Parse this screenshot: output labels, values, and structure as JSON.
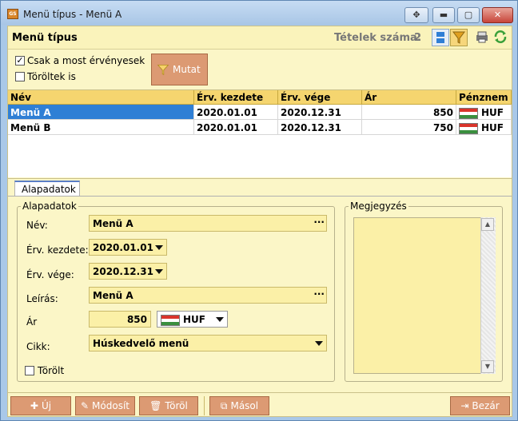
{
  "window": {
    "app_icon": "app-icon",
    "title": "Menü típus - Menü A",
    "caption_buttons": {
      "move": "✥",
      "minimize": "▬",
      "maximize": "▢",
      "close": "✕"
    }
  },
  "header": {
    "title": "Menü típus",
    "count_label": "Tételek száma:",
    "count_value": "2",
    "icons": [
      "layout-icon",
      "filter-icon",
      "printer-icon",
      "refresh-icon"
    ]
  },
  "filters": {
    "only_valid": {
      "label": "Csak a most érvényesek",
      "checked": true
    },
    "deleted_too": {
      "label": "Töröltek is",
      "checked": false
    },
    "show_button": "Mutat"
  },
  "grid": {
    "columns": [
      "Név",
      "Érv. kezdete",
      "Érv. vége",
      "Ár",
      "Pénznem"
    ],
    "rows": [
      {
        "name": "Menü A",
        "start": "2020.01.01",
        "end": "2020.12.31",
        "price": "850",
        "currency": "HUF",
        "selected": true
      },
      {
        "name": "Menü B",
        "start": "2020.01.01",
        "end": "2020.12.31",
        "price": "750",
        "currency": "HUF",
        "selected": false
      }
    ]
  },
  "tabs": [
    {
      "label": "Alapadatok",
      "active": true
    }
  ],
  "form": {
    "group_title": "Alapadatok",
    "name_label": "Név:",
    "name_value": "Menü A",
    "start_label": "Érv. kezdete:",
    "start_value": "2020.01.01",
    "end_label": "Érv. vége:",
    "end_value": "2020.12.31",
    "desc_label": "Leírás:",
    "desc_value": "Menü A",
    "price_label": "Ár",
    "price_value": "850",
    "currency_value": "HUF",
    "item_label": "Cikk:",
    "item_value": "Húskedvelő menü",
    "deleted_label": "Törölt",
    "deleted_checked": false,
    "ellipsis": "···"
  },
  "notes": {
    "title": "Megjegyzés",
    "value": ""
  },
  "footer": {
    "new": "Új",
    "modify": "Módosít",
    "delete": "Töröl",
    "copy": "Másol",
    "close": "Bezár"
  },
  "colors": {
    "accent_orange": "#dc9a73",
    "field_yellow": "#fbf0a7",
    "header_gold": "#f5d56f",
    "selection_blue": "#2f7fd5"
  }
}
